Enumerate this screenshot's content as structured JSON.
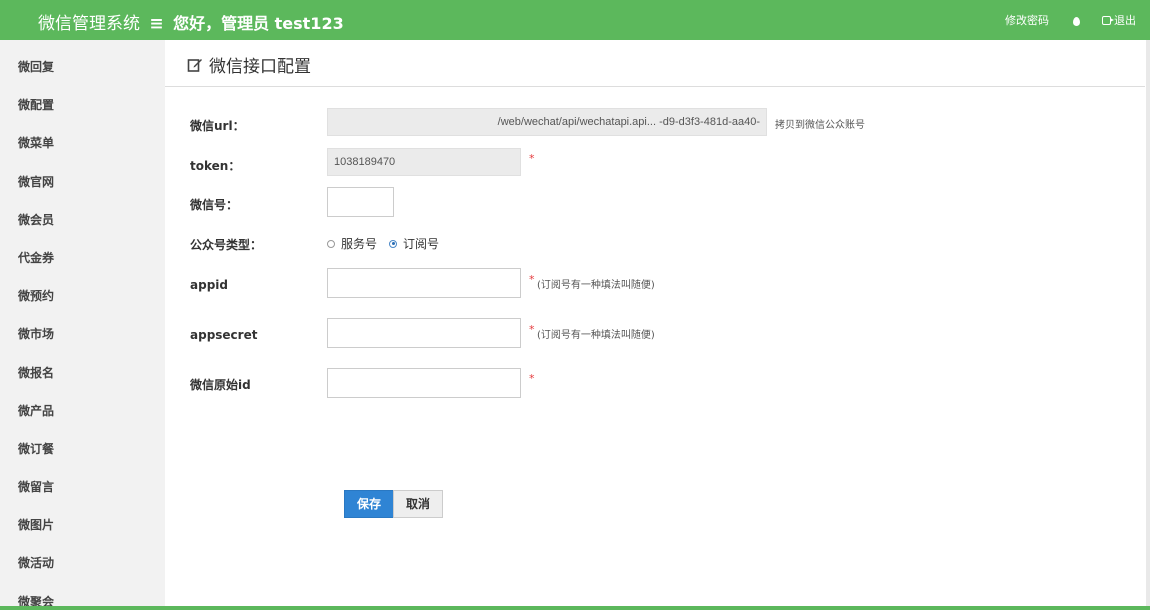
{
  "header": {
    "app_title": "微信管理系统",
    "menu_glyph": "≡",
    "greeting": "您好，管理员 test123",
    "change_password": "修改密码",
    "logout": "退出"
  },
  "sidebar": {
    "items": [
      "微回复",
      "微配置",
      "微菜单",
      "微官网",
      "微会员",
      "代金券",
      "微预约",
      "微市场",
      "微报名",
      "微产品",
      "微订餐",
      "微留言",
      "微图片",
      "微活动",
      "微聚会"
    ]
  },
  "page": {
    "title": "微信接口配置"
  },
  "form": {
    "url": {
      "label": "微信url：",
      "value": "/web/wechat/api/wechatapi.api...                      -d9-d3f3-481d-aa40-",
      "hint": "拷贝到微信公众账号"
    },
    "token": {
      "label": "token：",
      "value": "1038189470",
      "required": "*"
    },
    "wechat_id": {
      "label": "微信号：",
      "value": ""
    },
    "account_type": {
      "label": "公众号类型：",
      "options": [
        "服务号",
        "订阅号"
      ],
      "selected": "订阅号"
    },
    "appid": {
      "label": "appid",
      "value": "",
      "required": "*",
      "hint": "(订阅号有一种填法叫随便)"
    },
    "appsecret": {
      "label": "appsecret",
      "value": "",
      "required": "*",
      "hint": "(订阅号有一种填法叫随便)"
    },
    "original_id": {
      "label": "微信原始id",
      "value": "",
      "required": "*"
    }
  },
  "actions": {
    "save": "保存",
    "cancel": "取消"
  },
  "colors": {
    "header_bg": "#5cb85c",
    "primary_btn": "#2f84d4",
    "required_star": "#e4393c"
  }
}
